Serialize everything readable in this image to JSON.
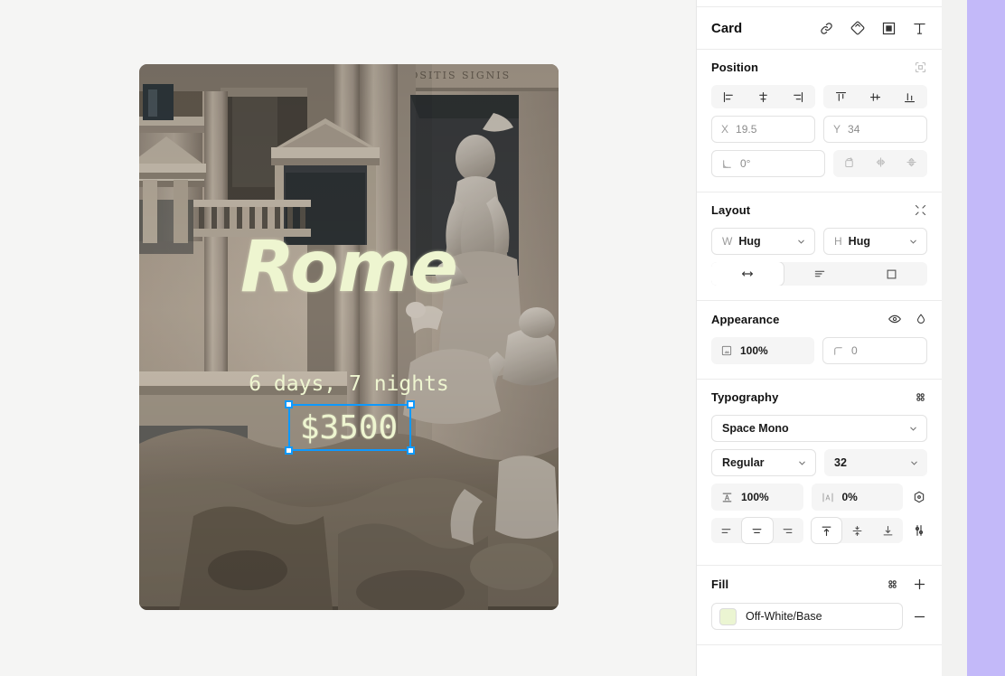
{
  "canvas": {
    "card": {
      "title": "Rome",
      "subtitle": "6 days, 7 nights",
      "price": "$3500",
      "title_color": "#EEF5D0",
      "background_color": "#F5F5F4"
    },
    "selection": {
      "color": "#0D99FF",
      "target": "$3500"
    }
  },
  "panel": {
    "header": {
      "object_name": "Card",
      "icons": [
        "link-icon",
        "component-icon",
        "frame-icon",
        "text-icon"
      ]
    },
    "position": {
      "title": "Position",
      "header_icon": "absolute-position-icon",
      "align_horizontal": [
        "align-left-icon",
        "align-center-horizontal-icon",
        "align-right-icon"
      ],
      "align_vertical": [
        "align-top-icon",
        "align-middle-vertical-icon",
        "align-bottom-icon"
      ],
      "x_label": "X",
      "x_value": "19.5",
      "y_label": "Y",
      "y_value": "34",
      "rotation_value": "0°",
      "rotation_icon": "angle-icon",
      "transform_icons": [
        "rotate-icon",
        "flip-horizontal-icon",
        "flip-vertical-icon"
      ]
    },
    "layout": {
      "title": "Layout",
      "header_icon": "collapse-icon",
      "width_label": "W",
      "width_value": "Hug",
      "height_label": "H",
      "height_value": "Hug",
      "mode_icons": [
        "horizontal-resize-icon",
        "text-lines-icon",
        "clip-content-icon"
      ]
    },
    "appearance": {
      "title": "Appearance",
      "header_icons": [
        "visibility-eye-icon",
        "blend-mode-icon"
      ],
      "opacity_icon": "opacity-icon",
      "opacity_value": "100%",
      "corner_icon": "corner-radius-icon",
      "corner_value": "0"
    },
    "typography": {
      "title": "Typography",
      "header_icon": "style-dots-icon",
      "font_family": "Space Mono",
      "font_weight": "Regular",
      "font_size": "32",
      "line_height_icon": "line-height-icon",
      "line_height_value": "100%",
      "letter_spacing_icon": "letter-spacing-icon",
      "letter_spacing_value": "0%",
      "detail_icon": "text-style-icon",
      "settings_icon": "type-settings-icon",
      "align_horizontal": [
        "text-align-left-icon",
        "text-align-center-icon",
        "text-align-right-icon"
      ],
      "align_vertical": [
        "text-valign-top-icon",
        "text-valign-middle-icon",
        "text-valign-bottom-icon"
      ]
    },
    "fill": {
      "title": "Fill",
      "header_icon": "style-dots-icon",
      "add_icon": "plus-icon",
      "swatch_color": "#EBF5D2",
      "name": "Off-White/Base",
      "remove_icon": "minus-icon"
    }
  }
}
